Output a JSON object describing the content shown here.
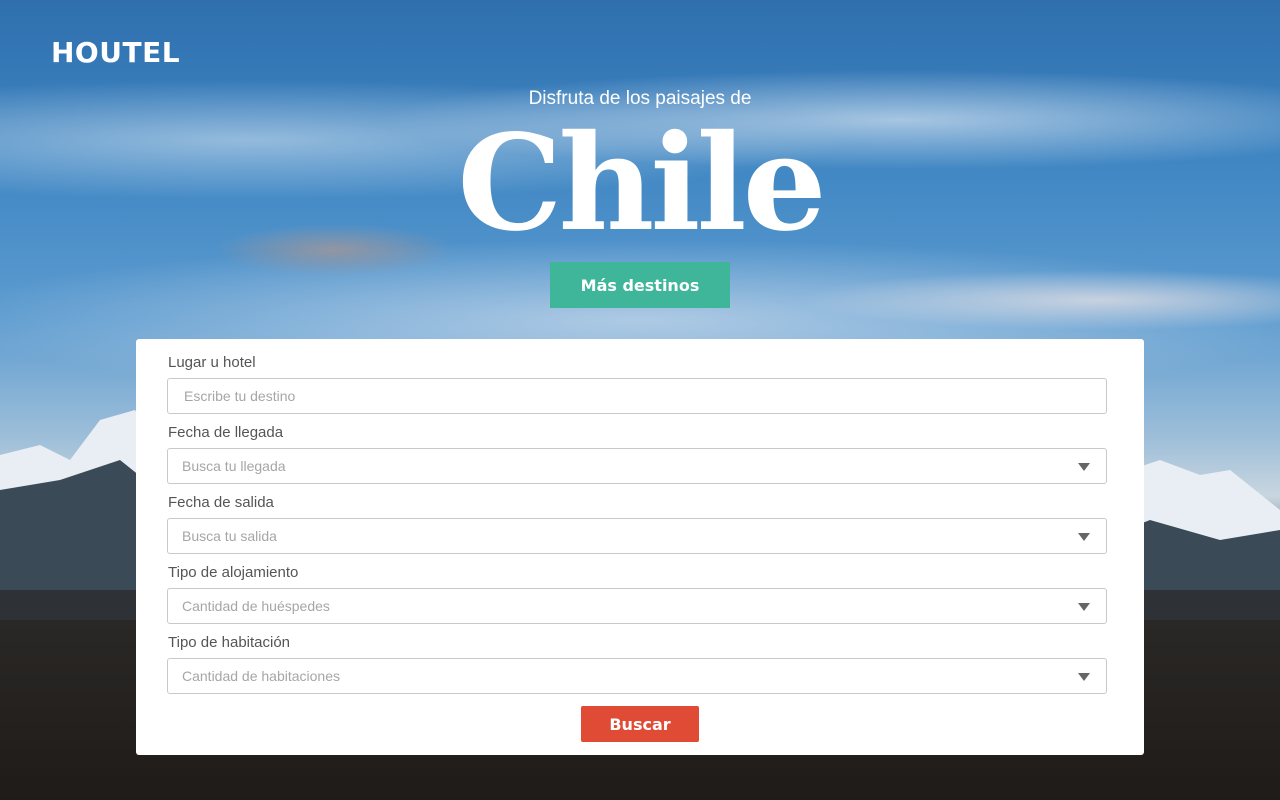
{
  "brand": {
    "logo_text": "HOUTEL"
  },
  "hero": {
    "subtitle": "Disfruta de los paisajes de",
    "title": "Chile",
    "more_button": "Más destinos"
  },
  "search_form": {
    "place": {
      "label": "Lugar u hotel",
      "placeholder": "Escribe tu destino"
    },
    "arrival": {
      "label": "Fecha de llegada",
      "value": "Busca tu llegada"
    },
    "departure": {
      "label": "Fecha de salida",
      "value": "Busca tu salida"
    },
    "lodging": {
      "label": "Tipo de alojamiento",
      "value": "Cantidad de huéspedes"
    },
    "room": {
      "label": "Tipo de habitación",
      "value": "Cantidad de habitaciones"
    },
    "submit_label": "Buscar"
  },
  "colors": {
    "accent_green": "#3fb69a",
    "accent_red": "#e04b36"
  },
  "icons": [
    "chevron-down-icon"
  ]
}
